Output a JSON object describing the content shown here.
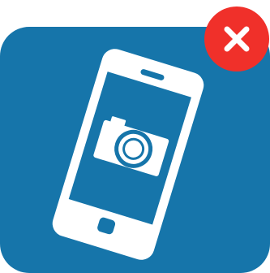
{
  "icon": {
    "tile_icon": "phone-camera-icon",
    "close_icon": "close-icon"
  },
  "colors": {
    "tile_background": "#1675aa",
    "phone": "#ffffff",
    "close_badge": "#f0302a",
    "close_glyph": "#ffffff"
  }
}
